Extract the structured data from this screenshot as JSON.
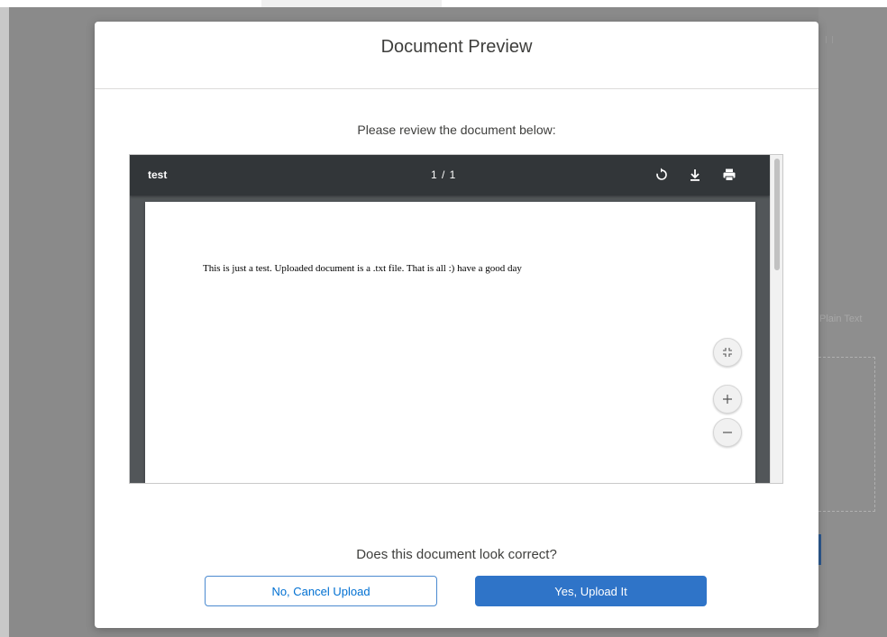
{
  "modal": {
    "title": "Document Preview",
    "instruction": "Please review the document below:",
    "question": "Does this document look correct?",
    "cancel_label": "No, Cancel Upload",
    "confirm_label": "Yes, Upload It"
  },
  "viewer": {
    "filename": "test",
    "page_counter": "1 / 1",
    "document_text": "This is just a test. Uploaded document is a .txt file. That is all :) have a good day",
    "tools": [
      "rotate-icon",
      "download-icon",
      "print-icon"
    ],
    "zoom_controls": [
      "fit-page-icon",
      "zoom-in-icon",
      "zoom-out-icon"
    ]
  },
  "background": {
    "hint_text": "Plain Text"
  },
  "colors": {
    "primary": "#2f74c8",
    "link": "#0070d2",
    "toolbar": "#323639",
    "viewer_bg": "#525659"
  }
}
